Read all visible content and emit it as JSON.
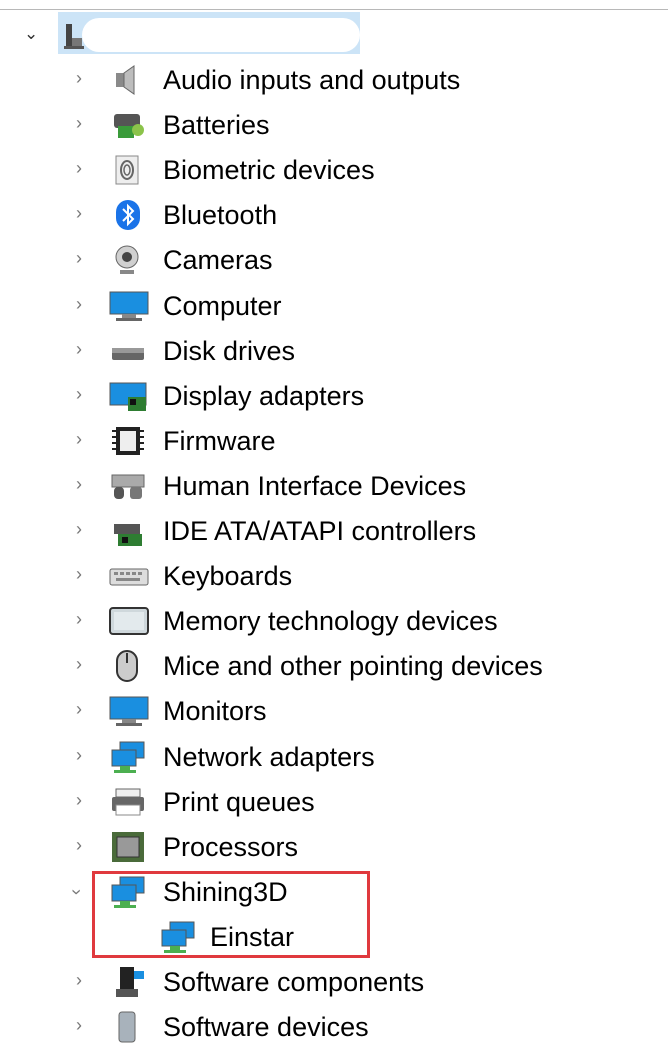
{
  "tree": {
    "root": {
      "expanded": true,
      "label": ""
    },
    "items": [
      {
        "label": "Audio inputs and outputs",
        "icon": "speaker-icon"
      },
      {
        "label": "Batteries",
        "icon": "battery-icon"
      },
      {
        "label": "Biometric devices",
        "icon": "fingerprint-icon"
      },
      {
        "label": "Bluetooth",
        "icon": "bluetooth-icon"
      },
      {
        "label": "Cameras",
        "icon": "webcam-icon"
      },
      {
        "label": "Computer",
        "icon": "computer-icon"
      },
      {
        "label": "Disk drives",
        "icon": "disk-drive-icon"
      },
      {
        "label": "Display adapters",
        "icon": "display-adapter-icon"
      },
      {
        "label": "Firmware",
        "icon": "chip-icon"
      },
      {
        "label": "Human Interface Devices",
        "icon": "hid-icon"
      },
      {
        "label": "IDE ATA/ATAPI controllers",
        "icon": "ide-controller-icon"
      },
      {
        "label": "Keyboards",
        "icon": "keyboard-icon"
      },
      {
        "label": "Memory technology devices",
        "icon": "memory-device-icon"
      },
      {
        "label": "Mice and other pointing devices",
        "icon": "mouse-icon"
      },
      {
        "label": "Monitors",
        "icon": "monitor-icon"
      },
      {
        "label": "Network adapters",
        "icon": "network-adapter-icon"
      },
      {
        "label": "Print queues",
        "icon": "printer-icon"
      },
      {
        "label": "Processors",
        "icon": "processor-icon"
      },
      {
        "label": "Shining3D",
        "icon": "network-adapter-icon",
        "expanded": true,
        "children": [
          {
            "label": "Einstar",
            "icon": "network-adapter-icon"
          }
        ]
      },
      {
        "label": "Software components",
        "icon": "software-component-icon"
      },
      {
        "label": "Software devices",
        "icon": "software-device-icon"
      }
    ]
  },
  "colors": {
    "highlight": "#e0393e",
    "selection": "#cce4f7"
  }
}
